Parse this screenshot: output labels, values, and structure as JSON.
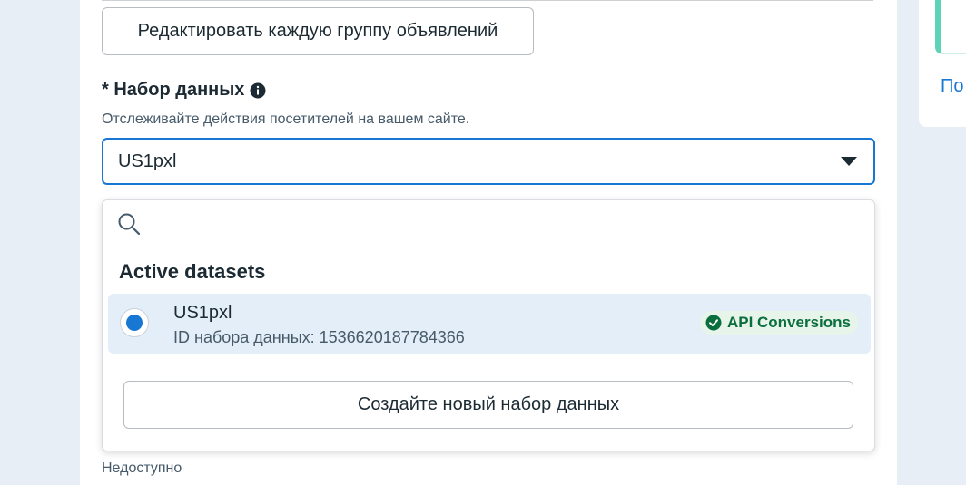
{
  "ad_settings": {
    "edit_groups_label": "Редактировать каждую группу объявлений"
  },
  "dataset_field": {
    "label": "* Набор данных",
    "info_icon": "info-icon",
    "description": "Отслеживайте действия посетителей на вашем сайте.",
    "selected_value": "US1pxl"
  },
  "dropdown": {
    "search": {
      "placeholder": "",
      "icon": "search-icon"
    },
    "group_title": "Active datasets",
    "options": [
      {
        "name": "US1pxl",
        "id_text": "ID набора данных: 1536620187784366",
        "badge": "API Conversions",
        "selected": true
      }
    ],
    "create_label": "Создайте новый набор данных"
  },
  "background_field": {
    "hint": "Недоступно"
  },
  "side_panel": {
    "link_text": "По"
  },
  "colors": {
    "accent": "#1877d2",
    "badge_green": "#0b6e3d",
    "side_accent": "#5fd3b5"
  }
}
